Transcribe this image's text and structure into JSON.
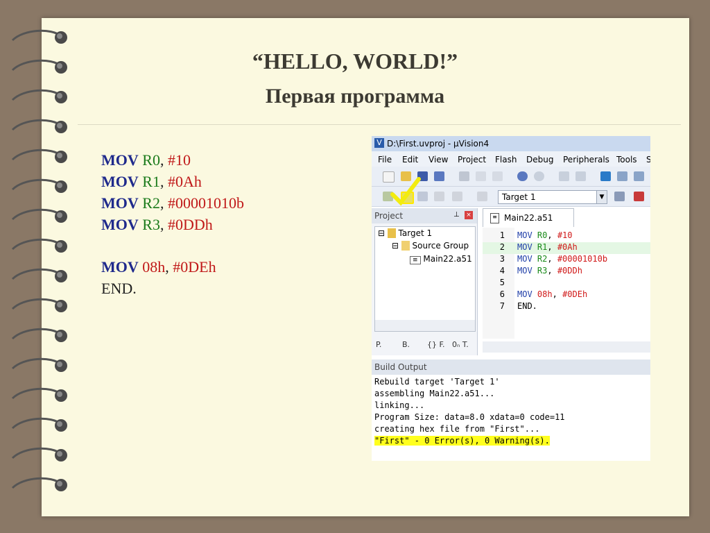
{
  "slide": {
    "title": "“HELLO, WORLD!”",
    "subtitle": "Первая программа"
  },
  "code": [
    {
      "op": "MOV",
      "dst": "R0",
      "sep": ", ",
      "src": "#10"
    },
    {
      "op": "MOV",
      "dst": "R1",
      "sep": ", ",
      "src": "#0Ah"
    },
    {
      "op": "MOV",
      "dst": "R2",
      "sep": ", ",
      "src": "#00001010b"
    },
    {
      "op": "MOV",
      "dst": "R3",
      "sep": ", ",
      "src": "#0DDh"
    },
    {
      "op": "MOV",
      "dst": "08h",
      "sep": ", ",
      "src": "#0DEh"
    },
    {
      "op": "",
      "dst": "",
      "sep": "",
      "src": "END."
    }
  ],
  "ide": {
    "window_title": "D:\\First.uvproj - µVision4",
    "menu": [
      "File",
      "Edit",
      "View",
      "Project",
      "Flash",
      "Debug",
      "Peripherals",
      "Tools",
      "S"
    ],
    "target_select": "Target 1",
    "project_pane": "Project",
    "tree": {
      "target": "Target 1",
      "group": "Source Group",
      "file": "Main22.a51"
    },
    "pane_tabs": [
      "P.",
      "B.",
      "{} F.",
      "0ₙ T."
    ],
    "editor_tab": "Main22.a51",
    "editor_lines": [
      {
        "n": "1",
        "kw": "MOV",
        "reg": "R0",
        "val": "#10"
      },
      {
        "n": "2",
        "kw": "MOV",
        "reg": "R1",
        "val": "#0Ah"
      },
      {
        "n": "3",
        "kw": "MOV",
        "reg": "R2",
        "val": "#00001010b"
      },
      {
        "n": "4",
        "kw": "MOV",
        "reg": "R3",
        "val": "#0DDh"
      },
      {
        "n": "5",
        "kw": "",
        "reg": "",
        "val": ""
      },
      {
        "n": "6",
        "kw": "MOV",
        "reg": "08h",
        "val": "#0DEh"
      },
      {
        "n": "7",
        "kw": "END.",
        "reg": "",
        "val": ""
      }
    ],
    "build_header": "Build Output",
    "build_output": [
      "Rebuild target 'Target 1'",
      "assembling Main22.a51...",
      "linking...",
      "Program Size: data=8.0 xdata=0 code=11",
      "creating hex file from \"First\"...",
      "\"First\" - 0 Error(s), 0 Warning(s)."
    ]
  },
  "colors": {
    "background": "#8a7866",
    "paper": "#fbf9e0",
    "mov": "#1f2a8c",
    "register": "#1a7a1a",
    "value": "#c01818",
    "highlight": "#ffff1e"
  }
}
